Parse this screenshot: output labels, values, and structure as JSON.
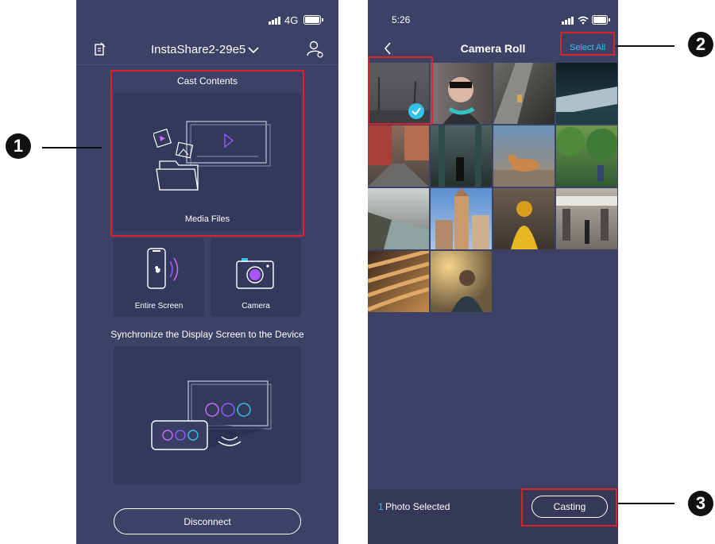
{
  "left_phone": {
    "status_network": "4G",
    "device_title": "InstaShare2-29e5",
    "cast_header": "Cast Contents",
    "media_label": "Media Files",
    "screen_label": "Entire Screen",
    "camera_label": "Camera",
    "sync_heading": "Synchronize the Display Screen to the Device",
    "disconnect_label": "Disconnect"
  },
  "right_phone": {
    "time": "5:26",
    "title": "Camera Roll",
    "select_all": "Select All",
    "selected_count": "1",
    "selected_text": "Photo Selected",
    "casting_label": "Casting"
  },
  "callouts": [
    "1",
    "2",
    "3"
  ],
  "colors": {
    "background": "#3e4166",
    "card": "#34385b",
    "accent": "#32c1e8",
    "highlight": "#d8232a",
    "callout": "#111111"
  },
  "icons": [
    "edit-icon",
    "chevron-down-icon",
    "user-settings-icon",
    "back-icon",
    "checkmark-icon",
    "apple-icon",
    "wifi-icon",
    "battery-icon",
    "signal-icon"
  ]
}
